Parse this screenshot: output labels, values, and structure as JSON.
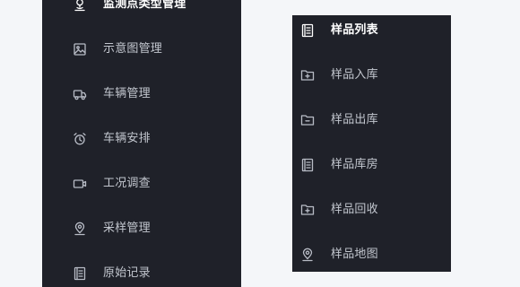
{
  "left_menu": {
    "items": [
      {
        "label": "监测点类型管理",
        "icon": "location-pin-icon",
        "active": true
      },
      {
        "label": "示意图管理",
        "icon": "image-icon"
      },
      {
        "label": "车辆管理",
        "icon": "truck-icon"
      },
      {
        "label": "车辆安排",
        "icon": "alarm-clock-icon"
      },
      {
        "label": "工况调查",
        "icon": "video-camera-icon"
      },
      {
        "label": "采样管理",
        "icon": "map-pin-icon"
      },
      {
        "label": "原始记录",
        "icon": "document-icon"
      }
    ]
  },
  "right_menu": {
    "items": [
      {
        "label": "样品列表",
        "icon": "document-icon",
        "active": true
      },
      {
        "label": "样品入库",
        "icon": "folder-plus-icon"
      },
      {
        "label": "样品出库",
        "icon": "folder-minus-icon"
      },
      {
        "label": "样品库房",
        "icon": "document-icon"
      },
      {
        "label": "样品回收",
        "icon": "folder-plus-icon"
      },
      {
        "label": "样品地图",
        "icon": "map-pin-icon"
      }
    ]
  },
  "colors": {
    "menu_bg": "#1f2129",
    "page_bg": "#f4f6f9",
    "text": "#c2c6ce",
    "active_text": "#ffffff"
  }
}
